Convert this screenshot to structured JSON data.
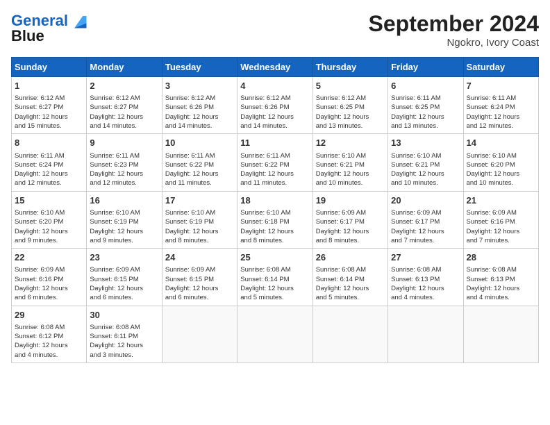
{
  "logo": {
    "line1": "General",
    "line2": "Blue"
  },
  "title": "September 2024",
  "location": "Ngokro, Ivory Coast",
  "days_header": [
    "Sunday",
    "Monday",
    "Tuesday",
    "Wednesday",
    "Thursday",
    "Friday",
    "Saturday"
  ],
  "weeks": [
    [
      {
        "day": "1",
        "text": "Sunrise: 6:12 AM\nSunset: 6:27 PM\nDaylight: 12 hours\nand 15 minutes."
      },
      {
        "day": "2",
        "text": "Sunrise: 6:12 AM\nSunset: 6:27 PM\nDaylight: 12 hours\nand 14 minutes."
      },
      {
        "day": "3",
        "text": "Sunrise: 6:12 AM\nSunset: 6:26 PM\nDaylight: 12 hours\nand 14 minutes."
      },
      {
        "day": "4",
        "text": "Sunrise: 6:12 AM\nSunset: 6:26 PM\nDaylight: 12 hours\nand 14 minutes."
      },
      {
        "day": "5",
        "text": "Sunrise: 6:12 AM\nSunset: 6:25 PM\nDaylight: 12 hours\nand 13 minutes."
      },
      {
        "day": "6",
        "text": "Sunrise: 6:11 AM\nSunset: 6:25 PM\nDaylight: 12 hours\nand 13 minutes."
      },
      {
        "day": "7",
        "text": "Sunrise: 6:11 AM\nSunset: 6:24 PM\nDaylight: 12 hours\nand 12 minutes."
      }
    ],
    [
      {
        "day": "8",
        "text": "Sunrise: 6:11 AM\nSunset: 6:24 PM\nDaylight: 12 hours\nand 12 minutes."
      },
      {
        "day": "9",
        "text": "Sunrise: 6:11 AM\nSunset: 6:23 PM\nDaylight: 12 hours\nand 12 minutes."
      },
      {
        "day": "10",
        "text": "Sunrise: 6:11 AM\nSunset: 6:22 PM\nDaylight: 12 hours\nand 11 minutes."
      },
      {
        "day": "11",
        "text": "Sunrise: 6:11 AM\nSunset: 6:22 PM\nDaylight: 12 hours\nand 11 minutes."
      },
      {
        "day": "12",
        "text": "Sunrise: 6:10 AM\nSunset: 6:21 PM\nDaylight: 12 hours\nand 10 minutes."
      },
      {
        "day": "13",
        "text": "Sunrise: 6:10 AM\nSunset: 6:21 PM\nDaylight: 12 hours\nand 10 minutes."
      },
      {
        "day": "14",
        "text": "Sunrise: 6:10 AM\nSunset: 6:20 PM\nDaylight: 12 hours\nand 10 minutes."
      }
    ],
    [
      {
        "day": "15",
        "text": "Sunrise: 6:10 AM\nSunset: 6:20 PM\nDaylight: 12 hours\nand 9 minutes."
      },
      {
        "day": "16",
        "text": "Sunrise: 6:10 AM\nSunset: 6:19 PM\nDaylight: 12 hours\nand 9 minutes."
      },
      {
        "day": "17",
        "text": "Sunrise: 6:10 AM\nSunset: 6:19 PM\nDaylight: 12 hours\nand 8 minutes."
      },
      {
        "day": "18",
        "text": "Sunrise: 6:10 AM\nSunset: 6:18 PM\nDaylight: 12 hours\nand 8 minutes."
      },
      {
        "day": "19",
        "text": "Sunrise: 6:09 AM\nSunset: 6:17 PM\nDaylight: 12 hours\nand 8 minutes."
      },
      {
        "day": "20",
        "text": "Sunrise: 6:09 AM\nSunset: 6:17 PM\nDaylight: 12 hours\nand 7 minutes."
      },
      {
        "day": "21",
        "text": "Sunrise: 6:09 AM\nSunset: 6:16 PM\nDaylight: 12 hours\nand 7 minutes."
      }
    ],
    [
      {
        "day": "22",
        "text": "Sunrise: 6:09 AM\nSunset: 6:16 PM\nDaylight: 12 hours\nand 6 minutes."
      },
      {
        "day": "23",
        "text": "Sunrise: 6:09 AM\nSunset: 6:15 PM\nDaylight: 12 hours\nand 6 minutes."
      },
      {
        "day": "24",
        "text": "Sunrise: 6:09 AM\nSunset: 6:15 PM\nDaylight: 12 hours\nand 6 minutes."
      },
      {
        "day": "25",
        "text": "Sunrise: 6:08 AM\nSunset: 6:14 PM\nDaylight: 12 hours\nand 5 minutes."
      },
      {
        "day": "26",
        "text": "Sunrise: 6:08 AM\nSunset: 6:14 PM\nDaylight: 12 hours\nand 5 minutes."
      },
      {
        "day": "27",
        "text": "Sunrise: 6:08 AM\nSunset: 6:13 PM\nDaylight: 12 hours\nand 4 minutes."
      },
      {
        "day": "28",
        "text": "Sunrise: 6:08 AM\nSunset: 6:13 PM\nDaylight: 12 hours\nand 4 minutes."
      }
    ],
    [
      {
        "day": "29",
        "text": "Sunrise: 6:08 AM\nSunset: 6:12 PM\nDaylight: 12 hours\nand 4 minutes."
      },
      {
        "day": "30",
        "text": "Sunrise: 6:08 AM\nSunset: 6:11 PM\nDaylight: 12 hours\nand 3 minutes."
      },
      {
        "day": "",
        "text": ""
      },
      {
        "day": "",
        "text": ""
      },
      {
        "day": "",
        "text": ""
      },
      {
        "day": "",
        "text": ""
      },
      {
        "day": "",
        "text": ""
      }
    ]
  ]
}
